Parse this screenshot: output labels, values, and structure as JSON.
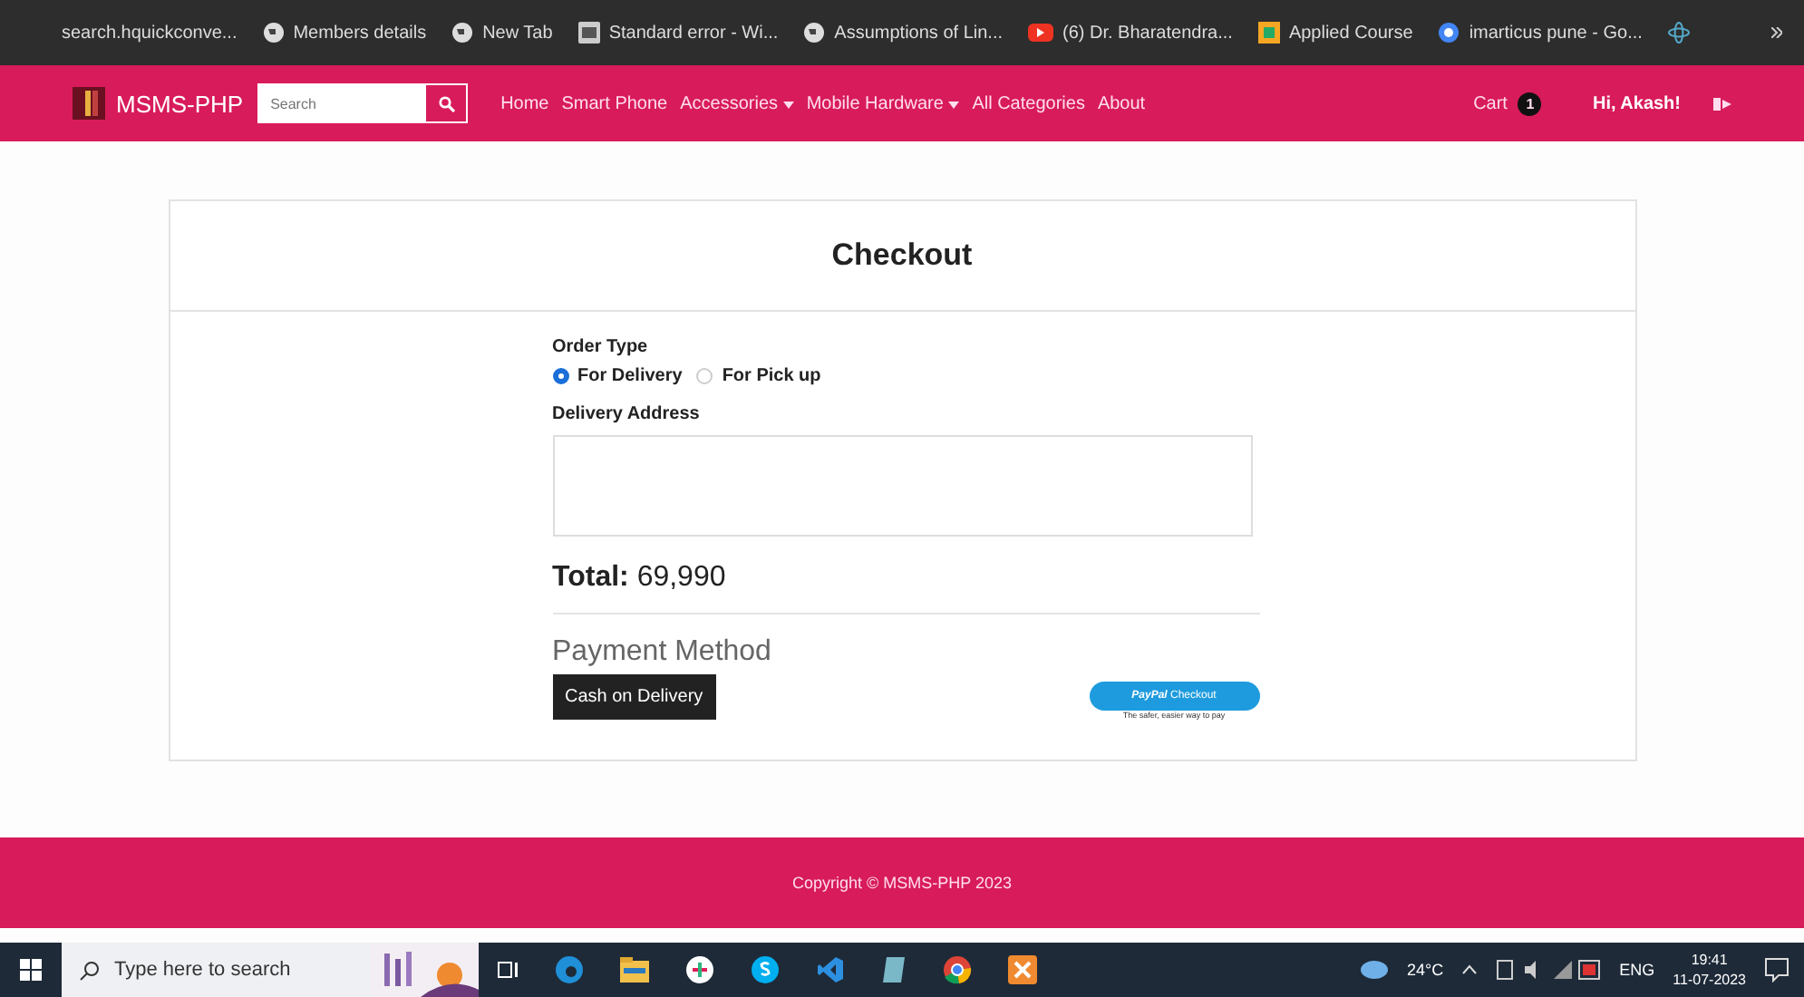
{
  "bookmarks": [
    {
      "label": "search.hquickconve...",
      "kind": "none"
    },
    {
      "label": "Members details",
      "kind": "globe"
    },
    {
      "label": "New Tab",
      "kind": "globe"
    },
    {
      "label": "Standard error - Wi...",
      "kind": "word"
    },
    {
      "label": "Assumptions of Lin...",
      "kind": "globe"
    },
    {
      "label": "(6) Dr. Bharatendra...",
      "kind": "video"
    },
    {
      "label": "Applied Course",
      "kind": "square"
    },
    {
      "label": "imarticus pune - Go...",
      "kind": "google"
    }
  ],
  "navbar": {
    "brand": "MSMS-PHP",
    "search": {
      "placeholder": "Search"
    },
    "links": [
      {
        "label": "Home",
        "dropdown": false
      },
      {
        "label": "Smart Phone",
        "dropdown": false
      },
      {
        "label": "Accessories",
        "dropdown": true
      },
      {
        "label": "Mobile Hardware",
        "dropdown": true
      },
      {
        "label": "All Categories",
        "dropdown": false
      },
      {
        "label": "About",
        "dropdown": false
      }
    ],
    "cart": {
      "label": "Cart",
      "count": "1"
    },
    "user": "Hi, Akash!"
  },
  "checkout": {
    "title": "Checkout",
    "order_type_label": "Order Type",
    "order_types": [
      {
        "label": "For Delivery",
        "selected": true
      },
      {
        "label": "For Pick up",
        "selected": false
      }
    ],
    "address_label": "Delivery Address",
    "total_label": "Total:",
    "total_value": "69,990",
    "payment_heading": "Payment Method",
    "cash_button": "Cash on Delivery",
    "paypal": {
      "brand": "PayPal",
      "action": "Checkout",
      "tagline": "The safer, easier way to pay"
    }
  },
  "footer": "Copyright © MSMS-PHP 2023",
  "taskbar": {
    "search_placeholder": "Type here to search",
    "weather": "24°C",
    "language": "ENG",
    "time": "19:41",
    "date": "11-07-2023"
  }
}
